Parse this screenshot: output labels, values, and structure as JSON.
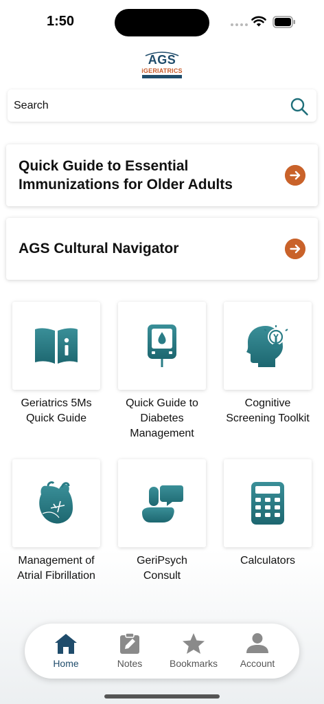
{
  "status_bar": {
    "time": "1:50"
  },
  "logo": {
    "name": "AGS",
    "subtitle": "iGERIATRICS"
  },
  "search": {
    "placeholder": "Search"
  },
  "cards": [
    {
      "line1": "Quick Guide to Essential",
      "line2": "Immunizations for Older Adults"
    },
    {
      "line1": "AGS Cultural Navigator"
    }
  ],
  "tiles": [
    {
      "icon": "book-icon",
      "line1": "Geriatrics 5Ms",
      "line2": "Quick Guide",
      "line3": ""
    },
    {
      "icon": "glucose-meter-icon",
      "line1": "Quick Guide to",
      "line2": "Diabetes",
      "line3": "Management"
    },
    {
      "icon": "head-lightbulb-icon",
      "line1": "Cognitive",
      "line2": "Screening Toolkit",
      "line3": ""
    },
    {
      "icon": "heart-icon",
      "line1": "Management of",
      "line2": "Atrial Fibrillation",
      "line3": ""
    },
    {
      "icon": "chat-bubbles-icon",
      "line1": "GeriPsych",
      "line2": "Consult",
      "line3": ""
    },
    {
      "icon": "calculator-icon",
      "line1": "Calculators",
      "line2": "",
      "line3": ""
    }
  ],
  "tab_bar": {
    "active": "Home",
    "items": [
      {
        "label": "Home",
        "icon": "home-icon"
      },
      {
        "label": "Notes",
        "icon": "notes-icon"
      },
      {
        "label": "Bookmarks",
        "icon": "star-icon"
      },
      {
        "label": "Account",
        "icon": "person-icon"
      }
    ]
  },
  "colors": {
    "accent": "#c9622a",
    "brand": "#1f4c6b",
    "icon_teal": "#2a7c86"
  }
}
